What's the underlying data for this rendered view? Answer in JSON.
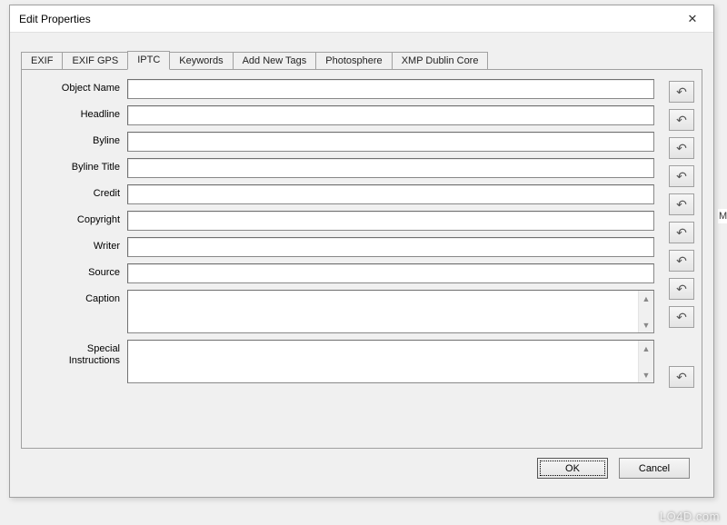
{
  "window": {
    "title": "Edit Properties",
    "close_label": "✕"
  },
  "tabs": [
    {
      "label": "EXIF",
      "active": false
    },
    {
      "label": "EXIF GPS",
      "active": false
    },
    {
      "label": "IPTC",
      "active": true
    },
    {
      "label": "Keywords",
      "active": false
    },
    {
      "label": "Add New Tags",
      "active": false
    },
    {
      "label": "Photosphere",
      "active": false
    },
    {
      "label": "XMP Dublin Core",
      "active": false
    }
  ],
  "fields": [
    {
      "label": "Object Name",
      "value": "",
      "type": "text"
    },
    {
      "label": "Headline",
      "value": "",
      "type": "text"
    },
    {
      "label": "Byline",
      "value": "",
      "type": "text"
    },
    {
      "label": "Byline Title",
      "value": "",
      "type": "text"
    },
    {
      "label": "Credit",
      "value": "",
      "type": "text"
    },
    {
      "label": "Copyright",
      "value": "",
      "type": "text"
    },
    {
      "label": "Writer",
      "value": "",
      "type": "text"
    },
    {
      "label": "Source",
      "value": "",
      "type": "text"
    },
    {
      "label": "Caption",
      "value": "",
      "type": "textarea"
    },
    {
      "label": "Special\nInstructions",
      "value": "",
      "type": "textarea"
    }
  ],
  "undo_icon": "↶",
  "buttons": {
    "ok": "OK",
    "cancel": "Cancel"
  },
  "background_fragment": "M",
  "watermark": "LO4D.com"
}
